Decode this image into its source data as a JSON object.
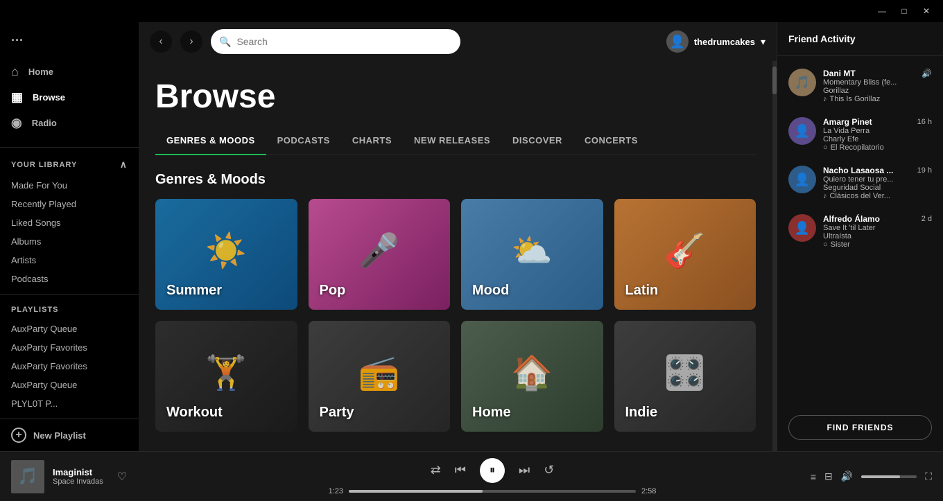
{
  "titlebar": {
    "minimize": "—",
    "maximize": "□",
    "close": "✕"
  },
  "sidebar": {
    "menu_label": "···",
    "nav_items": [
      {
        "id": "home",
        "label": "Home",
        "icon": "⌂"
      },
      {
        "id": "browse",
        "label": "Browse",
        "icon": "▦",
        "active": true
      },
      {
        "id": "radio",
        "label": "Radio",
        "icon": "◉"
      }
    ],
    "library_header": "Your Library",
    "library_items": [
      {
        "id": "made-for-you",
        "label": "Made For You"
      },
      {
        "id": "recently-played",
        "label": "Recently Played"
      },
      {
        "id": "liked-songs",
        "label": "Liked Songs"
      },
      {
        "id": "albums",
        "label": "Albums"
      },
      {
        "id": "artists",
        "label": "Artists"
      },
      {
        "id": "podcasts",
        "label": "Podcasts"
      }
    ],
    "playlists_header": "Playlists",
    "playlists": [
      {
        "id": "auxparty-queue-1",
        "label": "AuxParty Queue"
      },
      {
        "id": "auxparty-favorites-1",
        "label": "AuxParty Favorites"
      },
      {
        "id": "auxparty-favorites-2",
        "label": "AuxParty Favorites"
      },
      {
        "id": "auxparty-queue-2",
        "label": "AuxParty Queue"
      },
      {
        "id": "playlist-p",
        "label": "PLYL0T P..."
      }
    ],
    "new_playlist_label": "New Playlist"
  },
  "topbar": {
    "search_placeholder": "Search",
    "username": "thedrumcakes"
  },
  "browse": {
    "title": "Browse",
    "tabs": [
      {
        "id": "genres-moods",
        "label": "Genres & Moods",
        "active": true
      },
      {
        "id": "podcasts",
        "label": "Podcasts"
      },
      {
        "id": "charts",
        "label": "Charts"
      },
      {
        "id": "new-releases",
        "label": "New Releases"
      },
      {
        "id": "discover",
        "label": "Discover"
      },
      {
        "id": "concerts",
        "label": "Concerts"
      }
    ],
    "section_title": "Genres & Moods",
    "genres": [
      {
        "id": "summer",
        "label": "Summer",
        "icon": "☀",
        "color": "#1a6b9e"
      },
      {
        "id": "pop",
        "label": "Pop",
        "icon": "🎤",
        "color": "#b84b8f"
      },
      {
        "id": "mood",
        "label": "Mood",
        "icon": "🌤",
        "color": "#4a7ca8"
      },
      {
        "id": "latin",
        "label": "Latin",
        "icon": "🎸",
        "color": "#b87333"
      },
      {
        "id": "workout",
        "label": "Workout",
        "icon": "🏋",
        "color": "#2d2d2d"
      },
      {
        "id": "party",
        "label": "Party",
        "icon": "📻",
        "color": "#3d3d3d"
      },
      {
        "id": "home",
        "label": "Home",
        "icon": "🏠",
        "color": "#4d5d4d"
      },
      {
        "id": "indie",
        "label": "Indie",
        "icon": "🎛",
        "color": "#3d3d3d"
      }
    ]
  },
  "friend_activity": {
    "header": "Friend Activity",
    "friends": [
      {
        "id": "dani-mt",
        "name": "Dani MT",
        "track": "Momentary Bliss (fe...",
        "artist": "Gorillaz",
        "playlist": "This Is Gorillaz",
        "time": "",
        "speaking": true,
        "avatar_color": "#8B7355"
      },
      {
        "id": "amarg-pinet",
        "name": "Amarg Pinet",
        "track": "La Vida Perra",
        "artist": "Charly Efe",
        "playlist": "El Recopilatorio",
        "time": "16 h",
        "speaking": false,
        "avatar_color": "#5C4B8A"
      },
      {
        "id": "nacho-lasaosa",
        "name": "Nacho Lasaosa ...",
        "track": "Quiero tener tu pre...",
        "artist": "Seguridad Social",
        "playlist": "Clásicos del Ver...",
        "time": "19 h",
        "speaking": false,
        "avatar_color": "#2E5C8A"
      },
      {
        "id": "alfredo-alamo",
        "name": "Alfredo Álamo",
        "track": "Save It 'til Later",
        "artist": "Ultraísta",
        "playlist": "Sister",
        "time": "2 d",
        "speaking": false,
        "avatar_color": "#8A2E2E"
      }
    ],
    "find_friends_label": "FIND FRIENDS"
  },
  "now_playing": {
    "title": "Imaginist",
    "artist": "Space Invadas",
    "current_time": "1:23",
    "total_time": "2:58",
    "progress_pct": 46.7
  }
}
